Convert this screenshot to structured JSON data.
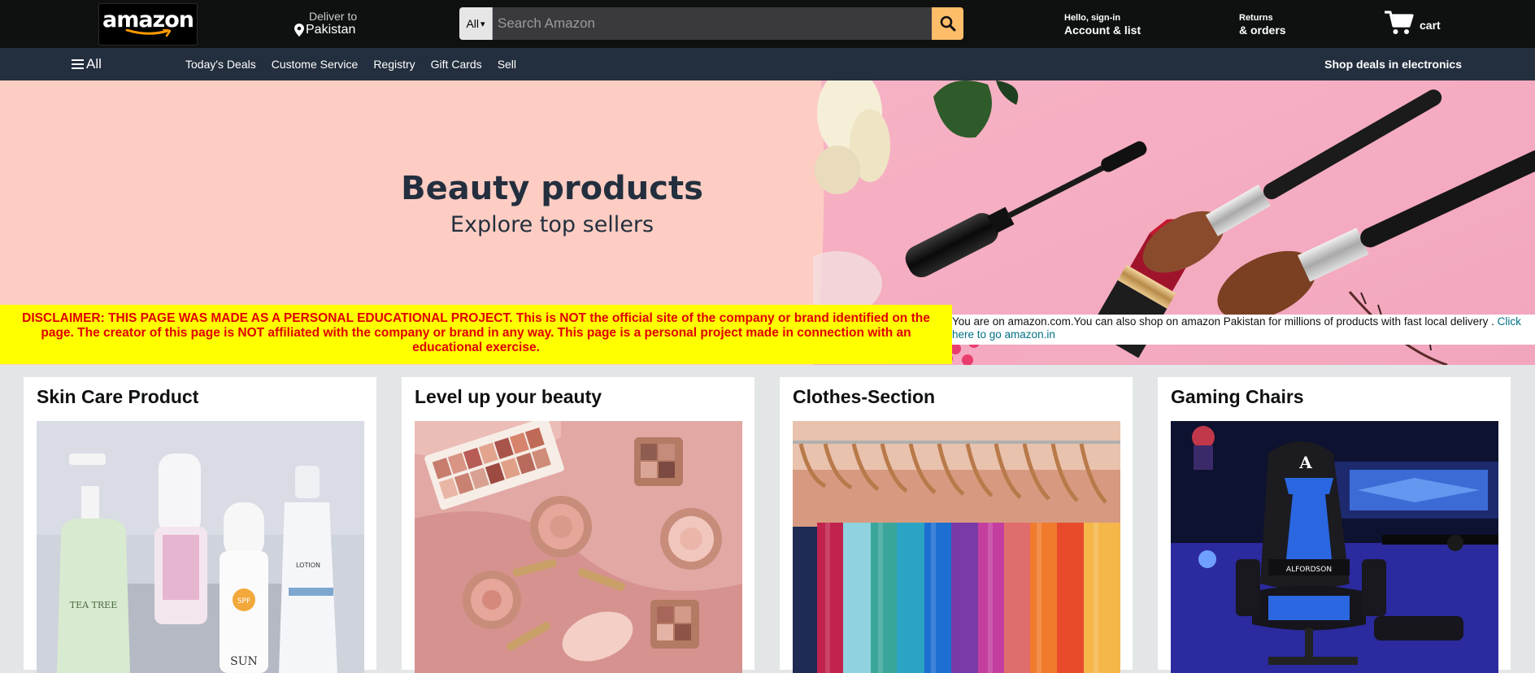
{
  "header": {
    "logo_text": "amazon",
    "deliver_line1": "Deliver to",
    "deliver_line2": "Pakistan",
    "search_category": "All",
    "search_placeholder": "Search Amazon",
    "account_line1": "Hello, sign-in",
    "account_line2": "Account & list",
    "returns_line1": "Returns",
    "returns_line2": "& orders",
    "cart_label": "cart"
  },
  "subnav": {
    "all_label": "All",
    "links": [
      "Today's Deals",
      "Custome Service",
      "Registry",
      "Gift Cards",
      "Sell"
    ],
    "promo": "Shop deals in electronics"
  },
  "hero": {
    "title": "Beauty products",
    "subtitle": "Explore top sellers"
  },
  "disclaimer": "DISCLAIMER: THIS PAGE WAS MADE AS A PERSONAL EDUCATIONAL PROJECT. This is NOT the official site of the company or brand identified on the page. The creator of this page is NOT affiliated with the company or brand in any way. This page is a personal project made in connection with an educational exercise.",
  "notice": {
    "text": "You are on amazon.com.You can also shop on amazon Pakistan for millions of products with fast local delivery .",
    "link": "Click here to go amazon.in"
  },
  "cards": [
    {
      "title": "Skin Care Product",
      "image": "skincare-bottles-image"
    },
    {
      "title": "Level up your beauty",
      "image": "makeup-palette-image"
    },
    {
      "title": "Clothes-Section",
      "image": "clothes-rack-image"
    },
    {
      "title": "Gaming Chairs",
      "image": "gaming-chair-image"
    }
  ],
  "colors": {
    "topnav": "#0f1111",
    "subnav": "#232f3e",
    "search_button": "#febd69",
    "hero_bg": "#fdcdc3",
    "disclaimer_bg": "#ffff00",
    "disclaimer_text": "#e00000",
    "link": "#007185"
  }
}
